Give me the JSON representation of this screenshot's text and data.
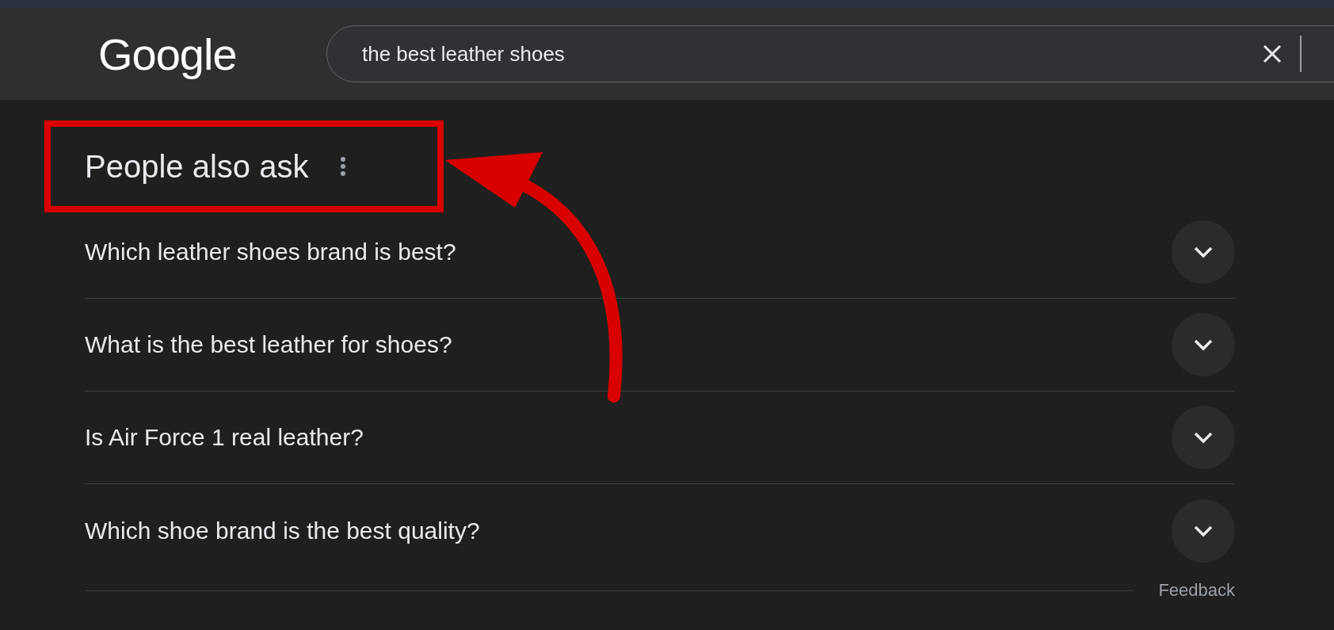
{
  "header": {
    "logo": "Google",
    "search": {
      "value": "the best leather shoes"
    }
  },
  "people_also_ask": {
    "title": "People also ask",
    "highlighted": true,
    "questions": [
      {
        "text": "Which leather shoes brand is best?",
        "expanded": false
      },
      {
        "text": "What is the best leather for shoes?",
        "expanded": false
      },
      {
        "text": "Is Air Force 1 real leather?",
        "expanded": false
      },
      {
        "text": "Which shoe brand is the best quality?",
        "expanded": false
      }
    ],
    "feedback": "Feedback"
  }
}
